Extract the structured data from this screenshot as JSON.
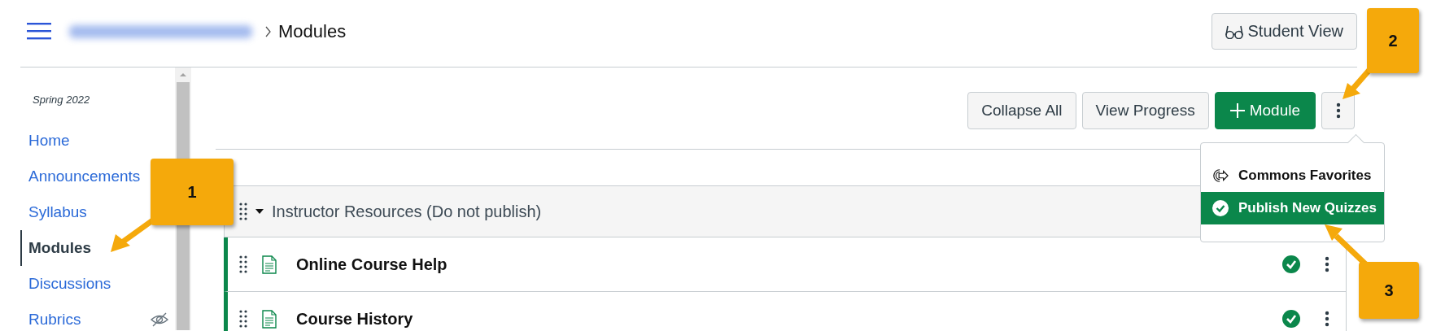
{
  "header": {
    "breadcrumb_current": "Modules",
    "student_view_button": "Student View"
  },
  "sidebar": {
    "term": "Spring 2022",
    "items": [
      {
        "label": "Home",
        "selected": false,
        "hidden": false
      },
      {
        "label": "Announcements",
        "selected": false,
        "hidden": false
      },
      {
        "label": "Syllabus",
        "selected": false,
        "hidden": false
      },
      {
        "label": "Modules",
        "selected": true,
        "hidden": false
      },
      {
        "label": "Discussions",
        "selected": false,
        "hidden": false
      },
      {
        "label": "Rubrics",
        "selected": false,
        "hidden": true
      }
    ]
  },
  "toolbar": {
    "buttons": [
      {
        "label": "Collapse All",
        "kind": "default"
      },
      {
        "label": "View Progress",
        "kind": "default"
      },
      {
        "label": "Module",
        "kind": "primary"
      }
    ]
  },
  "menu": {
    "items": [
      {
        "label": "Commons Favorites",
        "selected": false
      },
      {
        "label": "Publish New Quizzes",
        "selected": true
      }
    ]
  },
  "modules": [
    {
      "title": "Instructor Resources (Do not publish)",
      "expanded": true,
      "items": [
        {
          "title": "Online Course Help",
          "published": true
        },
        {
          "title": "Course History",
          "published": true
        }
      ]
    }
  ],
  "callouts": [
    "1",
    "2",
    "3"
  ]
}
